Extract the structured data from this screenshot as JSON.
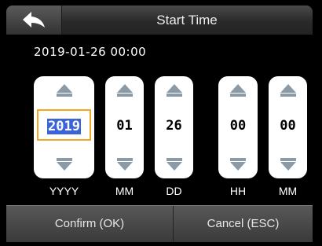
{
  "header": {
    "title": "Start Time",
    "back_icon": "back-arrow-icon"
  },
  "current_value": "2019-01-26 00:00",
  "spinners": [
    {
      "value": "2019",
      "unit": "YYYY",
      "active": true
    },
    {
      "value": "01",
      "unit": "MM",
      "active": false
    },
    {
      "value": "26",
      "unit": "DD",
      "active": false
    },
    {
      "value": "00",
      "unit": "HH",
      "active": false
    },
    {
      "value": "00",
      "unit": "MM",
      "active": false
    }
  ],
  "footer": {
    "confirm_label": "Confirm (OK)",
    "cancel_label": "Cancel (ESC)"
  },
  "colors": {
    "focus_border": "#f5a623",
    "selection": "#3a64d8",
    "arrow": "#8a9aa6"
  }
}
